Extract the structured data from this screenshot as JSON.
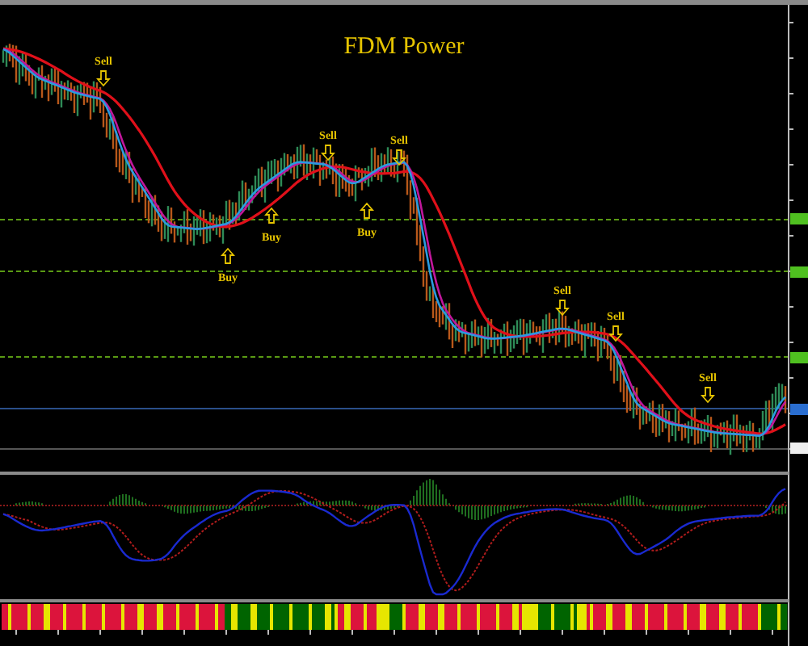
{
  "chart_title": "FDM Power",
  "signals": [
    {
      "kind": "sell",
      "label": "Sell"
    },
    {
      "kind": "buy",
      "label": "Buy"
    },
    {
      "kind": "buy",
      "label": "Buy"
    },
    {
      "kind": "sell",
      "label": "Sell"
    },
    {
      "kind": "buy",
      "label": "Buy"
    },
    {
      "kind": "sell",
      "label": "Sell"
    },
    {
      "kind": "sell",
      "label": "Sell"
    },
    {
      "kind": "sell",
      "label": "Sell"
    },
    {
      "kind": "sell",
      "label": "Sell"
    }
  ]
}
